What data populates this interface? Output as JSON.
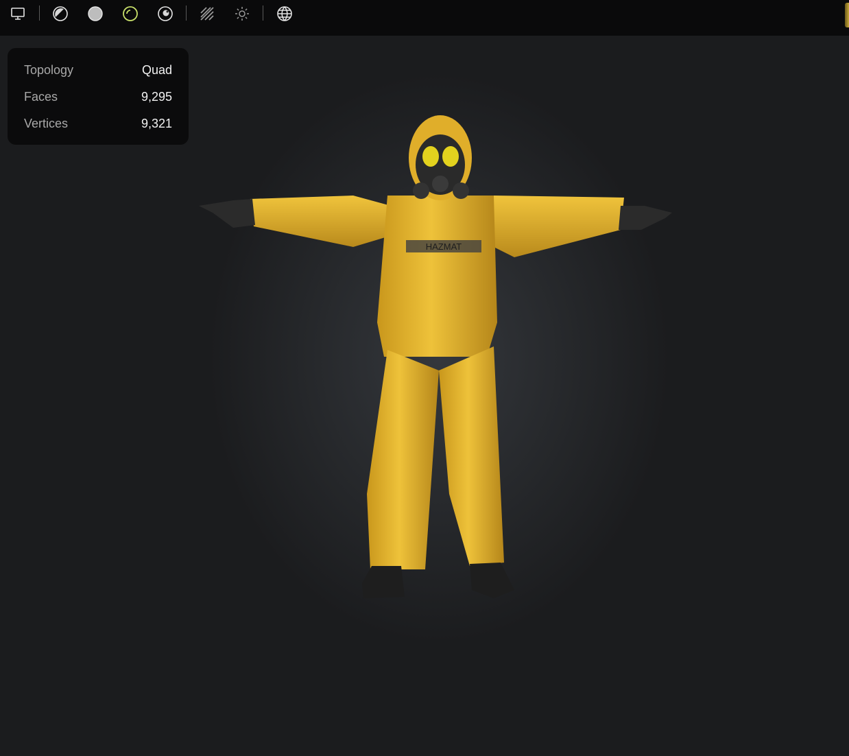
{
  "toolbar": {
    "icons": [
      "monitor-icon",
      "half-shaded-sphere-icon",
      "solid-sphere-icon",
      "outline-sphere-icon",
      "glossy-sphere-icon",
      "hatch-pattern-icon",
      "sun-icon",
      "globe-icon"
    ],
    "active_color": "#c8e06a"
  },
  "stats": {
    "topology_label": "Topology",
    "topology_value": "Quad",
    "faces_label": "Faces",
    "faces_value": "9,295",
    "vertices_label": "Vertices",
    "vertices_value": "9,321"
  },
  "model": {
    "chest_text": "HAZMAT",
    "suit_color": "#e5b52a",
    "mask_color": "#2a2a2a",
    "lens_color": "#e3d21e"
  }
}
